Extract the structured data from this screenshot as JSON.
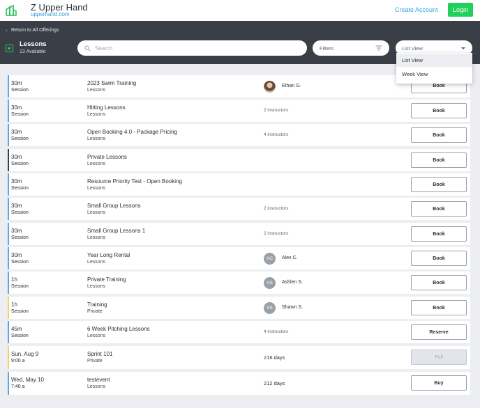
{
  "topbar": {
    "brand_name": "Z Upper Hand",
    "brand_url": "upperhand.com",
    "create_account": "Create Account",
    "login": "Login"
  },
  "header": {
    "back_link": "Return to All Offerings",
    "title": "Lessons",
    "available": "13 Available",
    "search_placeholder": "Search",
    "filters_label": "Filters",
    "view_selected": "List View"
  },
  "view_options": [
    "List View",
    "Week View"
  ],
  "colors": {
    "header_bg": "#3a3f47",
    "accent_green": "#1fd05a",
    "link_blue": "#2ea8e0",
    "bar_blue": "#5aa7e6",
    "bar_dark": "#3a3f47",
    "bar_yellow": "#f1d265"
  },
  "rows": [
    {
      "a": "30m",
      "b": "Session",
      "title": "2023 Swim Training",
      "type": "Lessons",
      "instr": "",
      "avatar": "photo",
      "initials": "",
      "name": "Ethan G.",
      "btn": "Book"
    },
    {
      "a": "30m",
      "b": "Session",
      "title": "Hitting Lessons",
      "type": "Lessons",
      "instr": "2 instructors",
      "btn": "Book"
    },
    {
      "a": "30m",
      "b": "Session",
      "title": "Open Booking 4.0 - Package Pricing",
      "type": "Lessons",
      "instr": "4 instructors",
      "btn": "Book"
    },
    {
      "a": "30m",
      "b": "Session",
      "title": "Private Lessons",
      "type": "Lessons",
      "instr": "",
      "btn": "Book"
    },
    {
      "a": "30m",
      "b": "Session",
      "title": "Resource Priority Test - Open Booking",
      "type": "Lessons",
      "instr": "",
      "btn": "Book"
    },
    {
      "a": "30m",
      "b": "Session",
      "title": "Small Group Lessons",
      "type": "Lessons",
      "instr": "2 instructors",
      "btn": "Book"
    },
    {
      "a": "30m",
      "b": "Session",
      "title": "Small Group Lessons 1",
      "type": "Lessons",
      "instr": "2 instructors",
      "btn": "Book"
    },
    {
      "a": "30m",
      "b": "Session",
      "title": "Year Long Rental",
      "type": "Lessons",
      "initials": "AC",
      "name": "Alex C.",
      "btn": "Book"
    },
    {
      "a": "1h",
      "b": "Session",
      "title": "Private Training",
      "type": "Lessons",
      "initials": "AS",
      "name": "Ashlen S.",
      "btn": "Book"
    },
    {
      "a": "1h",
      "b": "Session",
      "title": "Training",
      "type": "Private",
      "initials": "SS",
      "name": "Shawn S.",
      "btn": "Book"
    },
    {
      "a": "45m",
      "b": "Session",
      "title": "6 Week Pitching Lessons",
      "type": "Lessons",
      "instr": "4 instructors",
      "btn": "Reserve"
    },
    {
      "a": "Sun, Aug 9",
      "b": "9:00 a",
      "title": "Sprint 101",
      "type": "Private",
      "days": "216 days",
      "btn": "Full"
    },
    {
      "a": "Wed, May 10",
      "b": "7:40 a",
      "title": "testevent",
      "type": "Lessons",
      "days": "212 days",
      "btn": "Buy"
    }
  ]
}
